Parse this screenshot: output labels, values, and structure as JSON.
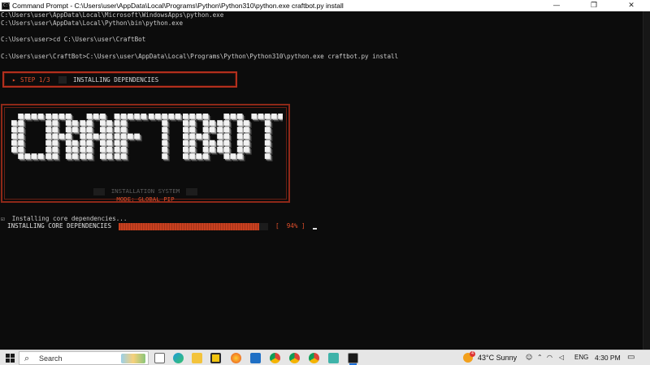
{
  "window": {
    "title": "Command Prompt - C:\\Users\\user\\AppData\\Local\\Programs\\Python\\Python310\\python.exe  craftbot.py install",
    "minimize": "—",
    "maximize": "❐",
    "close": "✕"
  },
  "console": {
    "lines": [
      "C:\\Users\\user\\AppData\\Local\\Microsoft\\WindowsApps\\python.exe",
      "C:\\Users\\user\\AppData\\Local\\Python\\bin\\python.exe",
      "C:\\Users\\user>cd C:\\Users\\user\\CraftBot",
      "C:\\Users\\user\\CraftBot>C:\\Users\\user\\AppData\\Local\\Programs\\Python\\Python310\\python.exe craftbot.py install"
    ],
    "step": {
      "arrow": "▸",
      "label": "STEP 1/3",
      "text": "INSTALLING DEPENDENCIES"
    },
    "banner": {
      "logo_text": "CRAFTBOT",
      "subtitle": "INSTALLATION SYSTEM",
      "mode": "MODE: GLOBAL PIP"
    },
    "status_line": "☑  Installing core dependencies...",
    "progress": {
      "label": "INSTALLING CORE DEPENDENCIES",
      "value": 0.94,
      "percent_text": "[  94% ]"
    }
  },
  "taskbar": {
    "search_placeholder": "Search",
    "apps": [
      "task-view",
      "edge",
      "file-explorer",
      "firefox",
      "mail",
      "chrome",
      "chrome",
      "chrome",
      "notepad",
      "command-prompt"
    ],
    "weather": {
      "badge": "4",
      "temp": "43°C",
      "condition": "Sunny"
    },
    "language": "ENG",
    "time": "4:30 PM"
  }
}
